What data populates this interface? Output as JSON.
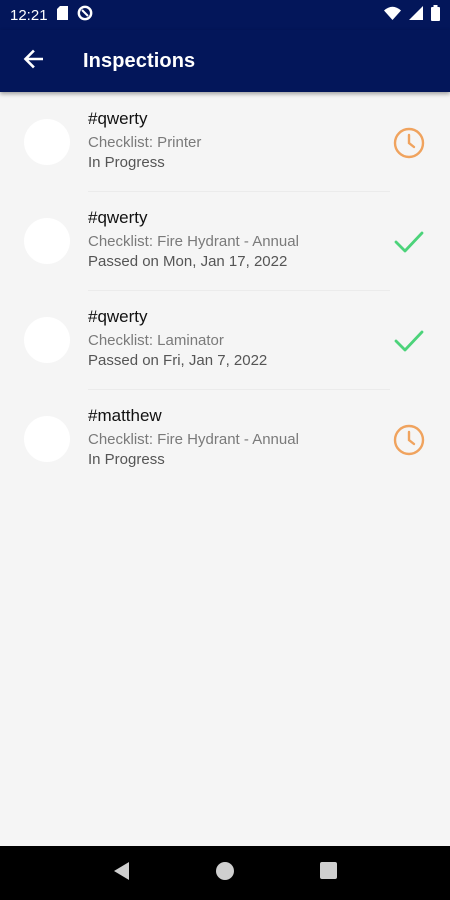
{
  "status_bar": {
    "time": "12:21",
    "icons": [
      "sim-card-icon",
      "data-saver-icon",
      "wifi-icon",
      "signal-icon",
      "battery-icon"
    ]
  },
  "app_bar": {
    "title": "Inspections",
    "back_icon": "arrow-left-icon"
  },
  "colors": {
    "primary": "#03165a",
    "in_progress": "#f0a35e",
    "passed": "#4cd37a",
    "background": "#f5f5f5"
  },
  "inspections": [
    {
      "title": "#qwerty",
      "checklist": "Checklist: Printer",
      "status": "In Progress",
      "state_icon": "clock-icon"
    },
    {
      "title": "#qwerty",
      "checklist": "Checklist: Fire Hydrant - Annual",
      "status": "Passed on Mon, Jan 17, 2022",
      "state_icon": "check-icon"
    },
    {
      "title": "#qwerty",
      "checklist": "Checklist: Laminator",
      "status": "Passed on Fri, Jan 7, 2022",
      "state_icon": "check-icon"
    },
    {
      "title": "#matthew",
      "checklist": "Checklist: Fire Hydrant - Annual",
      "status": "In Progress",
      "state_icon": "clock-icon"
    }
  ],
  "nav_bar": {
    "icons": [
      "back-triangle-icon",
      "home-circle-icon",
      "recents-square-icon"
    ]
  }
}
